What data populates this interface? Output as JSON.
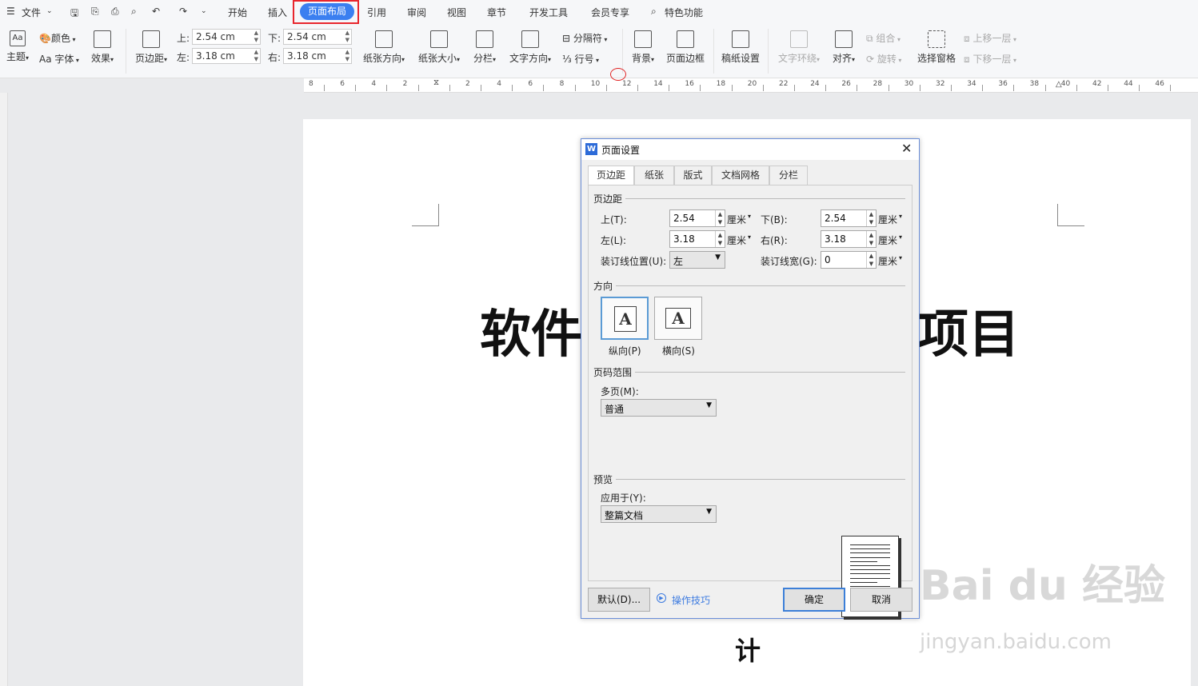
{
  "menu": {
    "file": "文件",
    "tabs": [
      "开始",
      "插入",
      "页面布局",
      "引用",
      "审阅",
      "视图",
      "章节",
      "开发工具",
      "会员专享"
    ],
    "active_tab": "页面布局",
    "special": "特色功能"
  },
  "toolbar": {
    "theme": "主题",
    "color": "颜色",
    "font": "Aa 字体",
    "effect": "效果",
    "margin": "页边距",
    "top_label": "上:",
    "top_value": "2.54 cm",
    "bottom_label": "下:",
    "bottom_value": "2.54 cm",
    "left_label": "左:",
    "left_value": "3.18 cm",
    "right_label": "右:",
    "right_value": "3.18 cm",
    "orientation": "纸张方向",
    "size": "纸张大小",
    "columns": "分栏",
    "text_dir": "文字方向",
    "break": "分隔符",
    "line_num": "行号",
    "background": "背景",
    "page_border": "页面边框",
    "draft": "稿纸设置",
    "wrap": "文字环绕",
    "align": "对齐",
    "group": "组合",
    "rotate": "旋转",
    "selection_pane": "选择窗格",
    "up_layer": "上移一层",
    "down_layer": "下移一层"
  },
  "ruler": {
    "numbers": [
      "8",
      "6",
      "4",
      "2",
      "",
      "2",
      "4",
      "6",
      "8",
      "10",
      "12",
      "14",
      "16",
      "18",
      "20",
      "22",
      "24",
      "26",
      "28",
      "30",
      "32",
      "34",
      "36",
      "38",
      "40",
      "42",
      "44",
      "46"
    ]
  },
  "document": {
    "title_left": "软件",
    "title_right": "项目",
    "bottom_char": "计"
  },
  "dialog": {
    "title": "页面设置",
    "tabs": [
      "页边距",
      "纸张",
      "版式",
      "文档网格",
      "分栏"
    ],
    "active_tab": "页边距",
    "margins_group": "页边距",
    "top_label": "上(T):",
    "top_value": "2.54",
    "bottom_label": "下(B):",
    "bottom_value": "2.54",
    "left_label": "左(L):",
    "left_value": "3.18",
    "right_label": "右(R):",
    "right_value": "3.18",
    "gutter_pos_label": "装订线位置(U):",
    "gutter_pos_value": "左",
    "gutter_label": "装订线宽(G):",
    "gutter_value": "0",
    "unit": "厘米",
    "orientation_group": "方向",
    "portrait": "纵向(P)",
    "landscape": "横向(S)",
    "portrait_glyph": "A",
    "landscape_glyph": "A",
    "pages_group": "页码范围",
    "multi_label": "多页(M):",
    "multi_value": "普通",
    "preview_group": "预览",
    "apply_label": "应用于(Y):",
    "apply_value": "整篇文档",
    "default_btn": "默认(D)...",
    "tips_link": "操作技巧",
    "ok_btn": "确定",
    "cancel_btn": "取消"
  },
  "watermark": {
    "brand": "Bai du 经验",
    "url": "jingyan.baidu.com"
  },
  "colors": {
    "active_tab_bg": "#3b7ff0",
    "highlight_box": "#e8262d",
    "dialog_border": "#6b8fd8",
    "link": "#3d7be0"
  }
}
